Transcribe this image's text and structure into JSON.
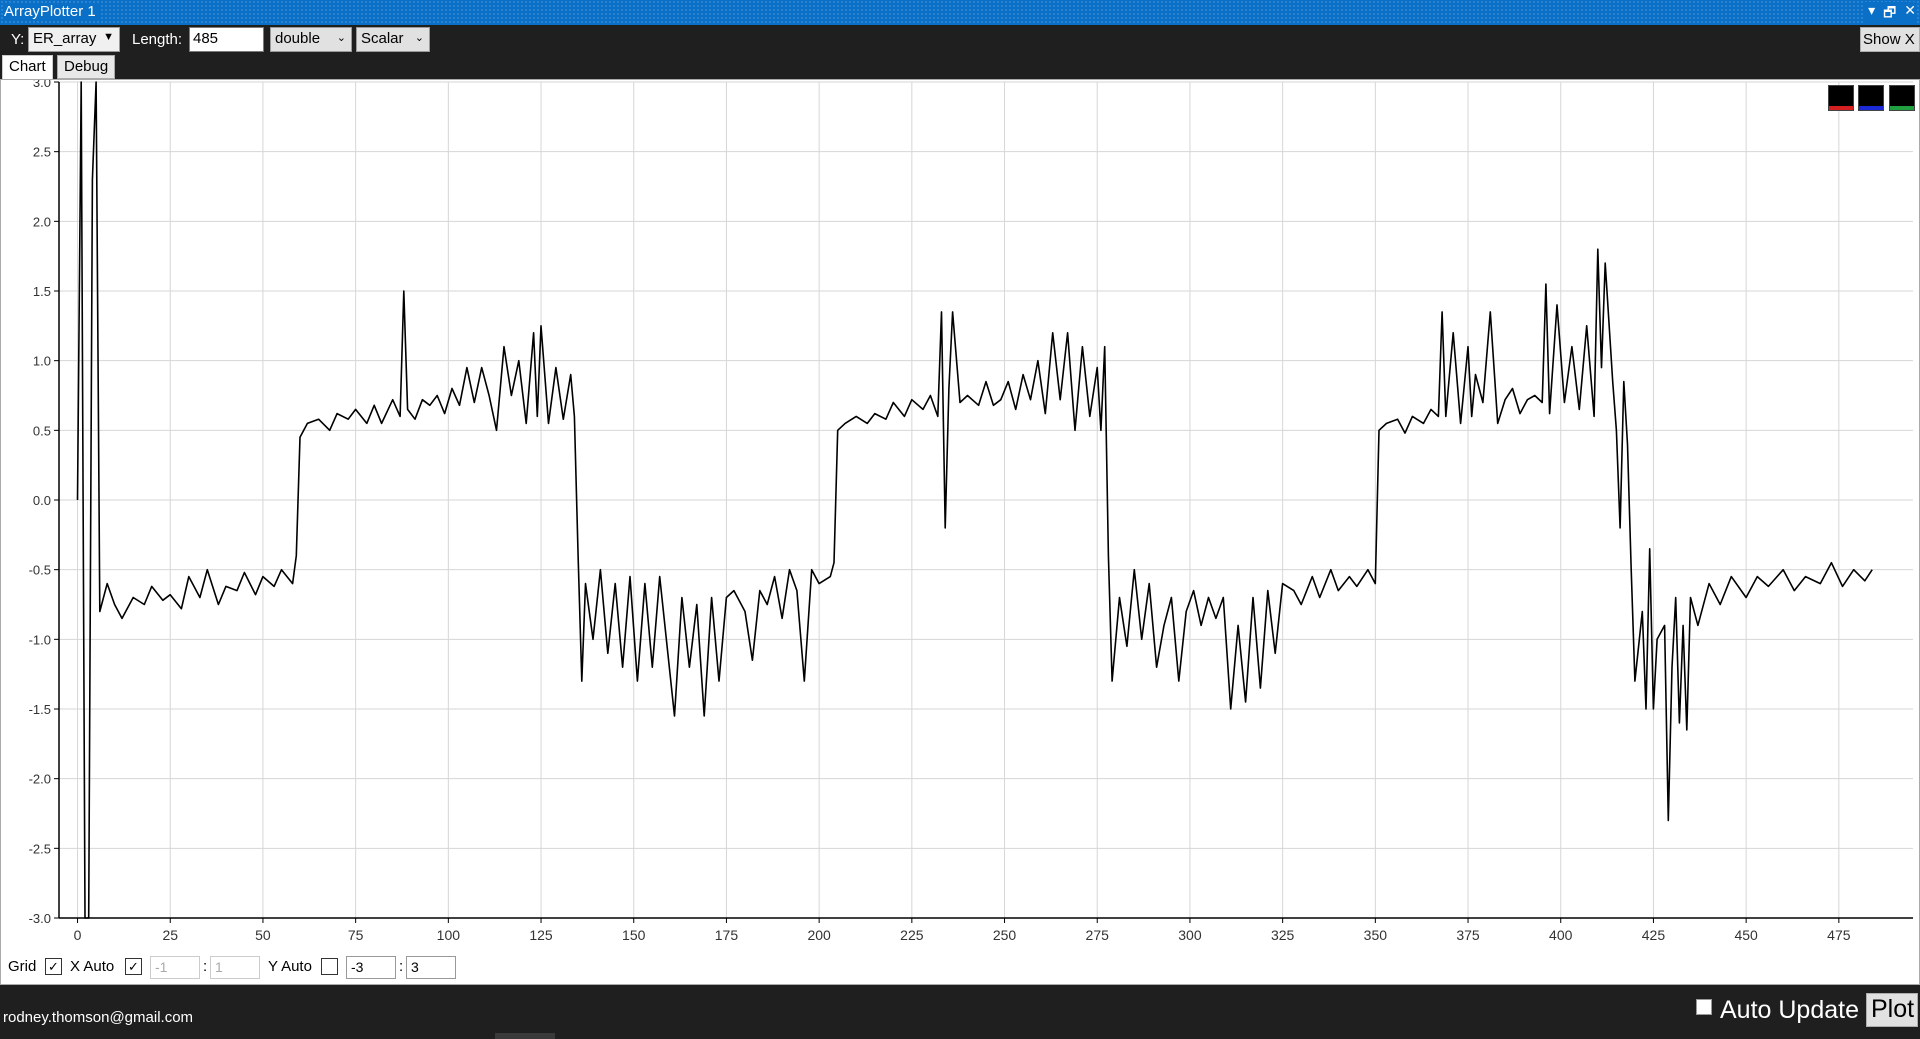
{
  "window": {
    "title": "ArrayPlotter 1",
    "controls": [
      "▾",
      "🗗",
      "✕"
    ]
  },
  "toolbar": {
    "y_label": "Y:",
    "y_select": "ER_array",
    "length_label": "Length:",
    "length_value": "485",
    "type_select": "double",
    "mode_select": "Scalar",
    "showx_label": "Show X"
  },
  "tabs": [
    {
      "label": "Chart"
    },
    {
      "label": "Debug"
    }
  ],
  "legend_swatches": [
    {
      "color": "#000000",
      "accent": "#d42020"
    },
    {
      "color": "#000000",
      "accent": "#1a2ad6"
    },
    {
      "color": "#000000",
      "accent": "#20a040"
    }
  ],
  "bottom_controls": {
    "grid_label": "Grid",
    "grid_checked": true,
    "xauto_label": "X Auto",
    "xauto_checked": true,
    "xmin": "-1",
    "xmax": "1",
    "x_sep": ":",
    "yauto_label": "Y Auto",
    "yauto_checked": false,
    "ymin": "-3",
    "ymax": "3",
    "y_sep": ":"
  },
  "status": {
    "email": "rodney.thomson@gmail.com",
    "auto_update_label": "Auto Update",
    "plot_label": "Plot"
  },
  "chart_data": {
    "type": "line",
    "title": "",
    "xlabel": "",
    "ylabel": "",
    "xlim": [
      -5,
      495
    ],
    "ylim": [
      -3,
      3
    ],
    "grid": true,
    "x_ticks": [
      0,
      25,
      50,
      75,
      100,
      125,
      150,
      175,
      200,
      225,
      250,
      275,
      300,
      325,
      350,
      375,
      400,
      425,
      450,
      475
    ],
    "y_ticks": [
      3.0,
      2.5,
      2.0,
      1.5,
      1.0,
      0.5,
      0.0,
      -0.5,
      -1.0,
      -1.5,
      -2.0,
      -2.5,
      -3.0
    ],
    "y_tick_labels": [
      "3.0",
      "2.5",
      "2.0",
      "1.5",
      "1.0",
      "0.5",
      "0.0",
      "-0.5",
      "-1.0",
      "-1.5",
      "-2.0",
      "-2.5",
      "-3.0"
    ],
    "series": [
      {
        "color": "#000000",
        "points": [
          [
            0,
            0.0
          ],
          [
            1,
            3.0
          ],
          [
            2,
            -3.0
          ],
          [
            3,
            -3.0
          ],
          [
            4,
            2.3
          ],
          [
            5,
            3.0
          ],
          [
            6,
            -0.8
          ],
          [
            8,
            -0.6
          ],
          [
            10,
            -0.75
          ],
          [
            12,
            -0.85
          ],
          [
            15,
            -0.7
          ],
          [
            18,
            -0.75
          ],
          [
            20,
            -0.62
          ],
          [
            23,
            -0.72
          ],
          [
            25,
            -0.68
          ],
          [
            28,
            -0.78
          ],
          [
            30,
            -0.55
          ],
          [
            33,
            -0.7
          ],
          [
            35,
            -0.5
          ],
          [
            38,
            -0.75
          ],
          [
            40,
            -0.62
          ],
          [
            43,
            -0.65
          ],
          [
            45,
            -0.52
          ],
          [
            48,
            -0.68
          ],
          [
            50,
            -0.55
          ],
          [
            53,
            -0.62
          ],
          [
            55,
            -0.5
          ],
          [
            58,
            -0.6
          ],
          [
            59,
            -0.4
          ],
          [
            60,
            0.45
          ],
          [
            62,
            0.55
          ],
          [
            65,
            0.58
          ],
          [
            68,
            0.5
          ],
          [
            70,
            0.62
          ],
          [
            73,
            0.58
          ],
          [
            75,
            0.65
          ],
          [
            78,
            0.55
          ],
          [
            80,
            0.68
          ],
          [
            82,
            0.55
          ],
          [
            85,
            0.72
          ],
          [
            87,
            0.6
          ],
          [
            88,
            1.5
          ],
          [
            89,
            0.65
          ],
          [
            91,
            0.58
          ],
          [
            93,
            0.72
          ],
          [
            95,
            0.68
          ],
          [
            97,
            0.75
          ],
          [
            99,
            0.62
          ],
          [
            101,
            0.8
          ],
          [
            103,
            0.68
          ],
          [
            105,
            0.95
          ],
          [
            107,
            0.7
          ],
          [
            109,
            0.95
          ],
          [
            111,
            0.75
          ],
          [
            113,
            0.5
          ],
          [
            115,
            1.1
          ],
          [
            117,
            0.75
          ],
          [
            119,
            1.0
          ],
          [
            121,
            0.55
          ],
          [
            123,
            1.2
          ],
          [
            124,
            0.6
          ],
          [
            125,
            1.25
          ],
          [
            127,
            0.55
          ],
          [
            129,
            0.95
          ],
          [
            131,
            0.58
          ],
          [
            133,
            0.9
          ],
          [
            134,
            0.6
          ],
          [
            135,
            -0.4
          ],
          [
            136,
            -1.3
          ],
          [
            137,
            -0.6
          ],
          [
            139,
            -1.0
          ],
          [
            141,
            -0.5
          ],
          [
            143,
            -1.1
          ],
          [
            145,
            -0.6
          ],
          [
            147,
            -1.2
          ],
          [
            149,
            -0.55
          ],
          [
            151,
            -1.3
          ],
          [
            153,
            -0.6
          ],
          [
            155,
            -1.2
          ],
          [
            157,
            -0.55
          ],
          [
            159,
            -1.05
          ],
          [
            161,
            -1.55
          ],
          [
            163,
            -0.7
          ],
          [
            165,
            -1.2
          ],
          [
            167,
            -0.75
          ],
          [
            169,
            -1.55
          ],
          [
            171,
            -0.7
          ],
          [
            173,
            -1.3
          ],
          [
            175,
            -0.7
          ],
          [
            177,
            -0.65
          ],
          [
            180,
            -0.8
          ],
          [
            182,
            -1.15
          ],
          [
            184,
            -0.65
          ],
          [
            186,
            -0.75
          ],
          [
            188,
            -0.55
          ],
          [
            190,
            -0.85
          ],
          [
            192,
            -0.5
          ],
          [
            194,
            -0.65
          ],
          [
            196,
            -1.3
          ],
          [
            198,
            -0.5
          ],
          [
            200,
            -0.6
          ],
          [
            203,
            -0.55
          ],
          [
            204,
            -0.45
          ],
          [
            205,
            0.5
          ],
          [
            207,
            0.55
          ],
          [
            210,
            0.6
          ],
          [
            213,
            0.55
          ],
          [
            215,
            0.62
          ],
          [
            218,
            0.58
          ],
          [
            220,
            0.7
          ],
          [
            223,
            0.6
          ],
          [
            225,
            0.72
          ],
          [
            228,
            0.65
          ],
          [
            230,
            0.75
          ],
          [
            232,
            0.6
          ],
          [
            233,
            1.35
          ],
          [
            234,
            -0.2
          ],
          [
            235,
            0.8
          ],
          [
            236,
            1.35
          ],
          [
            238,
            0.7
          ],
          [
            240,
            0.75
          ],
          [
            243,
            0.68
          ],
          [
            245,
            0.85
          ],
          [
            247,
            0.68
          ],
          [
            249,
            0.72
          ],
          [
            251,
            0.85
          ],
          [
            253,
            0.65
          ],
          [
            255,
            0.9
          ],
          [
            257,
            0.72
          ],
          [
            259,
            1.0
          ],
          [
            261,
            0.62
          ],
          [
            263,
            1.2
          ],
          [
            265,
            0.72
          ],
          [
            267,
            1.2
          ],
          [
            269,
            0.5
          ],
          [
            271,
            1.1
          ],
          [
            273,
            0.6
          ],
          [
            275,
            0.95
          ],
          [
            276,
            0.5
          ],
          [
            277,
            1.1
          ],
          [
            278,
            -0.4
          ],
          [
            279,
            -1.3
          ],
          [
            281,
            -0.7
          ],
          [
            283,
            -1.05
          ],
          [
            285,
            -0.5
          ],
          [
            287,
            -1.0
          ],
          [
            289,
            -0.6
          ],
          [
            291,
            -1.2
          ],
          [
            293,
            -0.9
          ],
          [
            295,
            -0.7
          ],
          [
            297,
            -1.3
          ],
          [
            299,
            -0.8
          ],
          [
            301,
            -0.65
          ],
          [
            303,
            -0.9
          ],
          [
            305,
            -0.7
          ],
          [
            307,
            -0.85
          ],
          [
            309,
            -0.7
          ],
          [
            311,
            -1.5
          ],
          [
            313,
            -0.9
          ],
          [
            315,
            -1.45
          ],
          [
            317,
            -0.7
          ],
          [
            319,
            -1.35
          ],
          [
            321,
            -0.65
          ],
          [
            323,
            -1.1
          ],
          [
            325,
            -0.6
          ],
          [
            328,
            -0.65
          ],
          [
            330,
            -0.75
          ],
          [
            333,
            -0.55
          ],
          [
            335,
            -0.7
          ],
          [
            338,
            -0.5
          ],
          [
            340,
            -0.65
          ],
          [
            343,
            -0.55
          ],
          [
            345,
            -0.62
          ],
          [
            348,
            -0.5
          ],
          [
            350,
            -0.6
          ],
          [
            351,
            0.5
          ],
          [
            353,
            0.55
          ],
          [
            356,
            0.58
          ],
          [
            358,
            0.48
          ],
          [
            360,
            0.6
          ],
          [
            363,
            0.55
          ],
          [
            365,
            0.65
          ],
          [
            367,
            0.6
          ],
          [
            368,
            1.35
          ],
          [
            369,
            0.6
          ],
          [
            371,
            1.2
          ],
          [
            373,
            0.55
          ],
          [
            375,
            1.1
          ],
          [
            376,
            0.6
          ],
          [
            377,
            0.9
          ],
          [
            379,
            0.7
          ],
          [
            381,
            1.35
          ],
          [
            383,
            0.55
          ],
          [
            385,
            0.72
          ],
          [
            387,
            0.8
          ],
          [
            389,
            0.62
          ],
          [
            391,
            0.72
          ],
          [
            393,
            0.75
          ],
          [
            395,
            0.7
          ],
          [
            396,
            1.55
          ],
          [
            397,
            0.62
          ],
          [
            399,
            1.4
          ],
          [
            401,
            0.7
          ],
          [
            403,
            1.1
          ],
          [
            405,
            0.65
          ],
          [
            407,
            1.25
          ],
          [
            409,
            0.6
          ],
          [
            410,
            1.8
          ],
          [
            411,
            0.95
          ],
          [
            412,
            1.7
          ],
          [
            414,
            0.85
          ],
          [
            415,
            0.5
          ],
          [
            416,
            -0.2
          ],
          [
            417,
            0.85
          ],
          [
            418,
            0.4
          ],
          [
            419,
            -0.5
          ],
          [
            420,
            -1.3
          ],
          [
            422,
            -0.8
          ],
          [
            423,
            -1.5
          ],
          [
            424,
            -0.35
          ],
          [
            425,
            -1.5
          ],
          [
            426,
            -1.0
          ],
          [
            428,
            -0.9
          ],
          [
            429,
            -2.3
          ],
          [
            430,
            -1.2
          ],
          [
            431,
            -0.7
          ],
          [
            432,
            -1.6
          ],
          [
            433,
            -0.9
          ],
          [
            434,
            -1.65
          ],
          [
            435,
            -0.7
          ],
          [
            437,
            -0.9
          ],
          [
            440,
            -0.6
          ],
          [
            443,
            -0.75
          ],
          [
            446,
            -0.55
          ],
          [
            450,
            -0.7
          ],
          [
            453,
            -0.55
          ],
          [
            456,
            -0.62
          ],
          [
            460,
            -0.5
          ],
          [
            463,
            -0.65
          ],
          [
            466,
            -0.55
          ],
          [
            470,
            -0.6
          ],
          [
            473,
            -0.45
          ],
          [
            476,
            -0.62
          ],
          [
            479,
            -0.5
          ],
          [
            482,
            -0.58
          ],
          [
            484,
            -0.5
          ]
        ]
      }
    ]
  }
}
